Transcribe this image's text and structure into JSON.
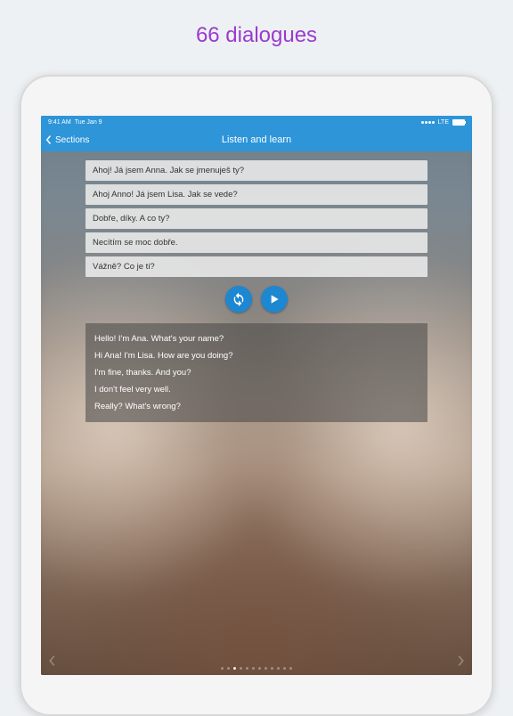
{
  "promo": {
    "title": "66 dialogues"
  },
  "status": {
    "time": "9:41 AM",
    "date": "Tue Jan 9",
    "carrier": "LTE"
  },
  "nav": {
    "back": "Sections",
    "title": "Listen and learn"
  },
  "dialogue": [
    "Ahoj! Já jsem Anna. Jak se jmenuješ ty?",
    "Ahoj Anno! Já jsem Lisa. Jak se vede?",
    "Dobře, díky. A co ty?",
    "Necítím se moc dobře.",
    "Vážně? Co je ti?"
  ],
  "translation": [
    "Hello! I'm Ana. What's your name?",
    "Hi Ana! I'm Lisa. How are you doing?",
    "I'm fine, thanks. And you?",
    "I don't feel very well.",
    "Really? What's wrong?"
  ],
  "pager": {
    "count": 12,
    "active": 2
  }
}
